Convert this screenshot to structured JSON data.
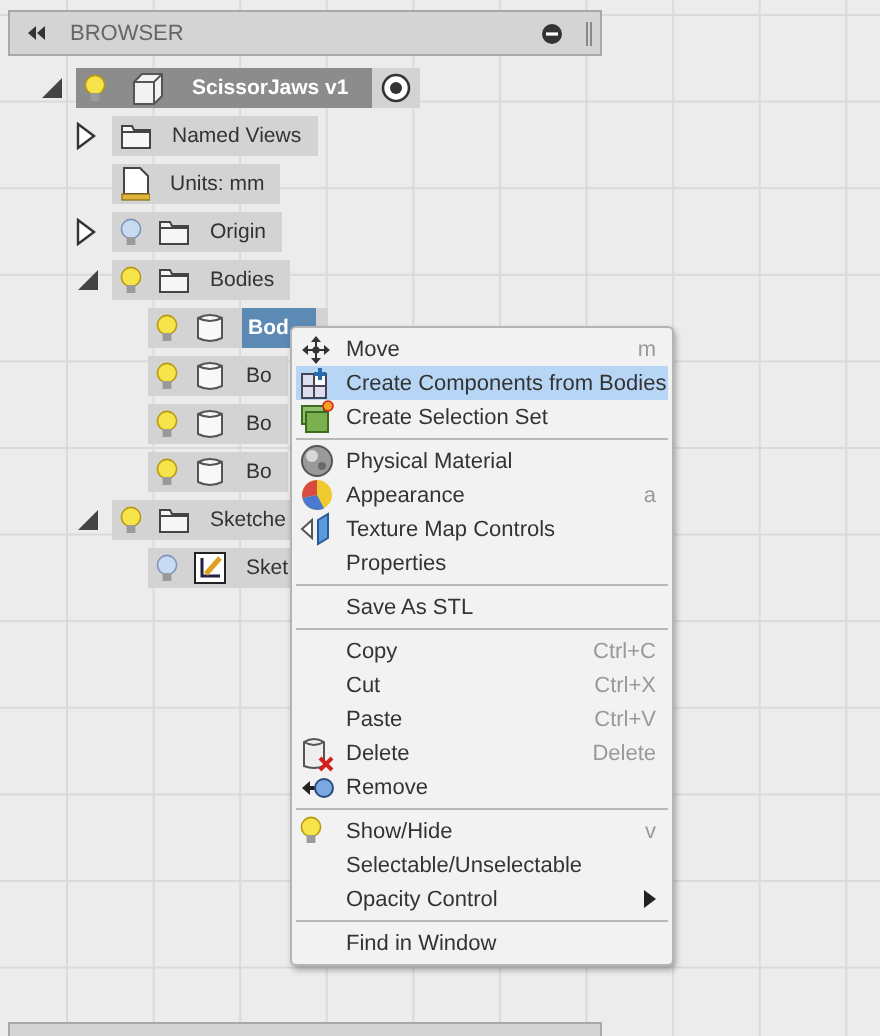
{
  "browser": {
    "title": "BROWSER"
  },
  "tree": [
    {
      "label": "ScissorJaws v1",
      "kind": "component",
      "expanded": true,
      "visible": true,
      "active": true,
      "selected": false,
      "children": [
        {
          "label": "Named Views",
          "kind": "folder",
          "expanded": false,
          "selected": false
        },
        {
          "label": "Units: mm",
          "kind": "units",
          "selected": false
        },
        {
          "label": "Origin",
          "kind": "folder",
          "expanded": false,
          "visible": false,
          "selected": false
        },
        {
          "label": "Bodies",
          "kind": "folder",
          "expanded": true,
          "visible": true,
          "selected": false,
          "children": [
            {
              "label": "Bod",
              "kind": "body",
              "visible": true,
              "selected": true
            },
            {
              "label": "Bo",
              "kind": "body",
              "visible": true,
              "selected": false
            },
            {
              "label": "Bo",
              "kind": "body",
              "visible": true,
              "selected": false
            },
            {
              "label": "Bo",
              "kind": "body",
              "visible": true,
              "selected": false
            }
          ]
        },
        {
          "label": "Sketche",
          "kind": "folder",
          "expanded": true,
          "visible": true,
          "selected": false,
          "children": [
            {
              "label": "Sket",
              "kind": "sketch",
              "visible": false,
              "selected": false
            }
          ]
        }
      ]
    }
  ],
  "context_menu": [
    {
      "kind": "move",
      "label": "Move",
      "shortcut": "m",
      "selected": false
    },
    {
      "kind": "components",
      "label": "Create Components from Bodies",
      "selected": true
    },
    {
      "kind": "selection",
      "label": "Create Selection Set",
      "selected": false
    },
    {
      "kind": "separator"
    },
    {
      "kind": "material",
      "label": "Physical Material",
      "selected": false
    },
    {
      "kind": "appearance",
      "label": "Appearance",
      "shortcut": "a",
      "selected": false
    },
    {
      "kind": "texture",
      "label": "Texture Map Controls",
      "selected": false
    },
    {
      "kind": "plain",
      "label": "Properties",
      "selected": false
    },
    {
      "kind": "separator"
    },
    {
      "kind": "plain",
      "label": "Save As STL",
      "selected": false
    },
    {
      "kind": "separator"
    },
    {
      "kind": "plain",
      "label": "Copy",
      "shortcut": "Ctrl+C",
      "selected": false
    },
    {
      "kind": "plain",
      "label": "Cut",
      "shortcut": "Ctrl+X",
      "selected": false
    },
    {
      "kind": "plain",
      "label": "Paste",
      "shortcut": "Ctrl+V",
      "selected": false
    },
    {
      "kind": "delete",
      "label": "Delete",
      "shortcut": "Delete",
      "selected": false
    },
    {
      "kind": "remove",
      "label": "Remove",
      "selected": false
    },
    {
      "kind": "separator"
    },
    {
      "kind": "visibility",
      "label": "Show/Hide",
      "shortcut": "v",
      "selected": false
    },
    {
      "kind": "plain",
      "label": "Selectable/Unselectable",
      "selected": false
    },
    {
      "kind": "plain",
      "label": "Opacity Control",
      "submenu": true,
      "selected": false
    },
    {
      "kind": "separator"
    },
    {
      "kind": "plain",
      "label": "Find in Window",
      "selected": false
    }
  ]
}
